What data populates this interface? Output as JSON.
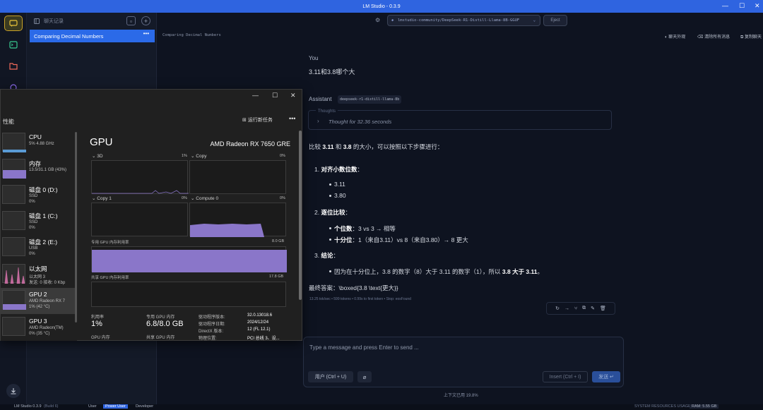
{
  "window": {
    "title": "LM Studio - 0.3.9"
  },
  "sidebar": {
    "header": "聊天记录",
    "active_chat": "Comparing Decimal Numbers",
    "more": "•••"
  },
  "header": {
    "model": "lmstudio-community/DeepSeek-R1-Distill-Llama-8B-GGUF",
    "eject": "Eject",
    "conv_title": "Comparing Decimal Numbers",
    "actions": [
      "聊天外观",
      "清除所有消息",
      "复制聊天"
    ]
  },
  "messages": {
    "user": {
      "role": "You",
      "text": "3.11和3.8哪个大"
    },
    "assistant": {
      "role": "Assistant",
      "model_tag": "deepseek-r1-distill-llama-8b",
      "thoughts_label": "Thoughts",
      "thoughts_text": "Thought for 32.36 seconds",
      "intro_a": "比较 ",
      "intro_b": "3.11",
      "intro_c": " 和 ",
      "intro_d": "3.8",
      "intro_e": " 的大小，可以按照以下步骤进行：",
      "s1_num": "1.",
      "s1_title": "对齐小数位数",
      "s1_colon": "：",
      "s1_items": [
        "3.11",
        "3.80"
      ],
      "s2_num": "2.",
      "s2_title": "逐位比较",
      "s2_colon": "：",
      "s2_i1_b": "个位数",
      "s2_i1_t": "：3 vs 3 → 相等",
      "s2_i2_b": "十分位",
      "s2_i2_t": "：1（来自3.11）vs 8（来自3.80）→ 8 更大",
      "s3_num": "3.",
      "s3_title": "结论",
      "s3_colon": "：",
      "s3_t1": "因为在十分位上，3.8 的数字（8）大于 3.11 的数字（1），所以 ",
      "s3_b": "3.8 大于 3.11",
      "s3_t2": "。",
      "final": "最终答案：\\boxed{3.8 \\text{更大}}",
      "stats": "13.25 tok/sec • 599 tokens • 0.99s to first token • Stop: eosFound"
    }
  },
  "composer": {
    "placeholder": "Type a message and press Enter to send ...",
    "user_btn": "用户 (Ctrl + U)",
    "insert": "Insert (Ctrl + I)",
    "send": "发送 ↵",
    "context": "上下文已用 19.8%"
  },
  "statusbar": {
    "app": "LM Studio 0.3.9",
    "build": "(Build 6)",
    "modes": [
      "User",
      "Power User",
      "Developer"
    ],
    "resources": "SYSTEM RESOURCES USAGE:",
    "ram": "RAM: 5.55 GB"
  },
  "taskmgr": {
    "section": "性能",
    "run_task": "运行新任务",
    "more": "•••",
    "devices": [
      {
        "name": "CPU",
        "sub1": "5% 4.88 GHz",
        "sub2": ""
      },
      {
        "name": "内存",
        "sub1": "13.5/31.1 GB (43%)",
        "sub2": ""
      },
      {
        "name": "磁盘 0 (D:)",
        "sub1": "SSD",
        "sub2": "0%"
      },
      {
        "name": "磁盘 1 (C:)",
        "sub1": "SSD",
        "sub2": "0%"
      },
      {
        "name": "磁盘 2 (E:)",
        "sub1": "USB",
        "sub2": "0%"
      },
      {
        "name": "以太网",
        "sub1": "以太网 3",
        "sub2": "发送: 0 接收: 0 Kbp"
      },
      {
        "name": "GPU 2",
        "sub1": "AMD Radeon RX 7",
        "sub2": "1% (42 °C)"
      },
      {
        "name": "GPU 3",
        "sub1": "AMD Radeon(TM)",
        "sub2": "0% (35 °C)"
      }
    ],
    "gpu": {
      "title": "GPU",
      "model": "AMD Radeon RX 7650 GRE",
      "g3d": "3D",
      "g3d_pct": "1%",
      "gcopy": "Copy",
      "gcopy_pct": "0%",
      "gcopy1": "Copy 1",
      "gcopy1_pct": "0%",
      "gcompute": "Compute 0",
      "gcompute_pct": "0%",
      "ded_label": "专用 GPU 内存利用率",
      "ded_max": "8.0 GB",
      "shared_label": "共享 GPU 内存利用率",
      "shared_max": "17.8 GB",
      "util_label": "利用率",
      "util_val": "1%",
      "ded_mem_label": "专用 GPU 内存",
      "ded_mem_val": "6.8/8.0 GB",
      "gpu_mem_label": "GPU 内存",
      "shared_mem_label": "共享 GPU 内存",
      "drv_ver_label": "驱动程序版本:",
      "drv_ver": "32.0.13018.6",
      "drv_date_label": "驱动程序日期:",
      "drv_date": "2024/12/24",
      "dx_label": "DirectX 版本:",
      "dx": "12 (FL 12.1)",
      "loc_label": "物理位置:",
      "loc": "PCI 总线 3、设..."
    }
  }
}
